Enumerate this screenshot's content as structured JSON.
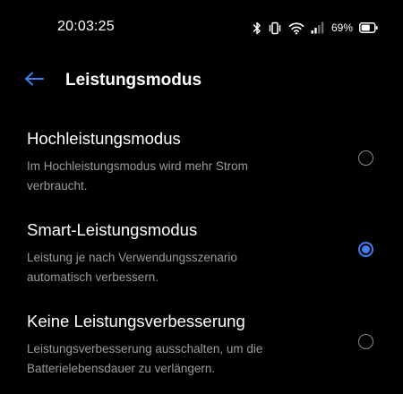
{
  "status_bar": {
    "time": "20:03:25",
    "battery_percent": "69%",
    "icons": [
      "bluetooth-icon",
      "vibrate-icon",
      "wifi-icon",
      "signal-icon",
      "battery-icon"
    ]
  },
  "header": {
    "back_icon": "arrow-left-icon",
    "title": "Leistungsmodus"
  },
  "colors": {
    "background": "#000000",
    "accent": "#3d7ff0",
    "text_primary": "#ffffff",
    "text_secondary": "#9a9a9a"
  },
  "options": [
    {
      "title": "Hochleistungsmodus",
      "description": "Im Hochleistungsmodus wird mehr Strom verbraucht.",
      "selected": false
    },
    {
      "title": "Smart-Leistungsmodus",
      "description": "Leistung je nach Verwendungsszenario automatisch verbessern.",
      "selected": true
    },
    {
      "title": "Keine Leistungsverbesserung",
      "description": "Leistungsverbesserung ausschalten, um die Batterielebensdauer zu verlängern.",
      "selected": false
    }
  ]
}
